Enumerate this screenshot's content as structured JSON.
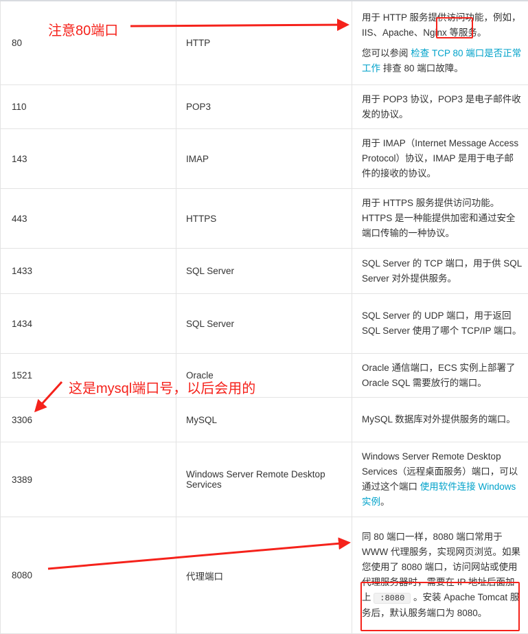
{
  "rows": [
    {
      "port": "80",
      "service": "HTTP",
      "desc": [
        "用于 HTTP 服务提供访问功能，例如，IIS、Apache、Nginx 等服务。"
      ],
      "desc2_pre": "您可以参阅 ",
      "desc2_link": "检查 TCP 80 端口是否正常工作",
      "desc2_post": " 排查 80 端口故障。"
    },
    {
      "port": "110",
      "service": "POP3",
      "desc": [
        "用于 POP3 协议，POP3 是电子邮件收发的协议。"
      ]
    },
    {
      "port": "143",
      "service": "IMAP",
      "desc": [
        "用于 IMAP（Internet Message Access Protocol）协议，IMAP 是用于电子邮件的接收的协议。"
      ]
    },
    {
      "port": "443",
      "service": "HTTPS",
      "desc": [
        "用于 HTTPS 服务提供访问功能。HTTPS 是一种能提供加密和通过安全端口传输的一种协议。"
      ]
    },
    {
      "port": "1433",
      "service": "SQL Server",
      "desc": [
        "SQL Server 的 TCP 端口，用于供 SQL Server 对外提供服务。"
      ]
    },
    {
      "port": "1434",
      "service": "SQL Server",
      "desc": [
        "SQL Server 的 UDP 端口，用于返回 SQL Server 使用了哪个 TCP/IP 端口。"
      ]
    },
    {
      "port": "1521",
      "service": "Oracle",
      "desc": [
        "Oracle 通信端口，ECS 实例上部署了 Oracle SQL 需要放行的端口。"
      ]
    },
    {
      "port": "3306",
      "service": "MySQL",
      "desc": [
        "MySQL 数据库对外提供服务的端口。"
      ]
    },
    {
      "port": "3389",
      "service": "Windows Server Remote Desktop Services",
      "desc_pre": "Windows Server Remote Desktop Services（远程桌面服务）端口，可以通过这个端口 ",
      "desc_link": "使用软件连接 Windows实例",
      "desc_post": "。"
    },
    {
      "port": "8080",
      "service": "代理端口",
      "desc_pre": "同 80 端口一样，8080 端口常用于 WWW 代理服务，实现网页浏览。如果您使用了 8080 端口，访问网站或使用代理服务器时，需要在 IP 地址后面加上 ",
      "desc_code": ":8080",
      "desc_post": " 。安装 Apache Tomcat 服务后，默认服务端口为 8080。"
    }
  ],
  "annotations": {
    "note_80": "注意80端口",
    "note_mysql": "这是mysql端口号，以后会用的",
    "color": "#f5221b"
  },
  "colors": {
    "link": "#00a2ca"
  }
}
